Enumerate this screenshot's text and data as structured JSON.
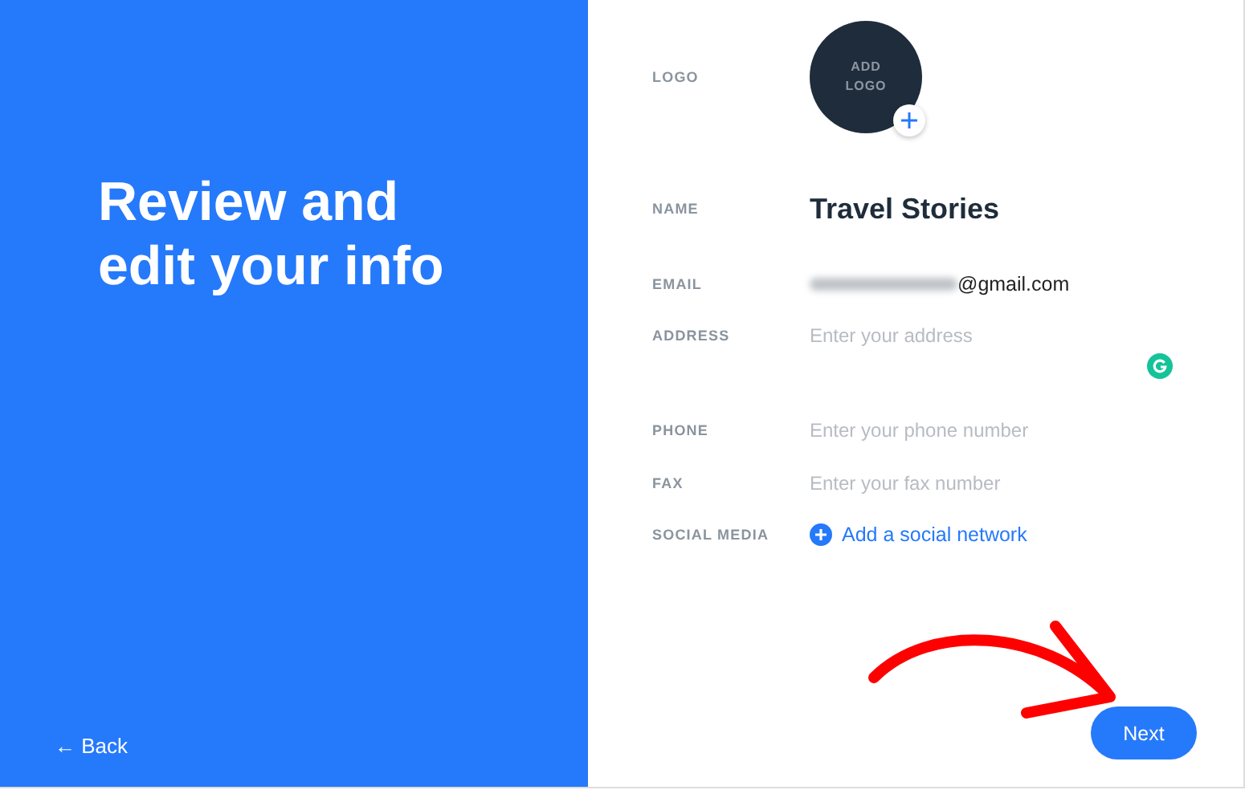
{
  "intro": {
    "title": "Review and edit your info",
    "back_link": "← Back"
  },
  "fields": [
    {
      "kind": "logo",
      "label": "LOGO",
      "value": "ADD LOGO"
    },
    {
      "kind": "name",
      "label": "NAME",
      "value": "Travel Stories"
    },
    {
      "kind": "email",
      "label": "EMAIL",
      "value": "@gmail.com"
    },
    {
      "kind": "textarea",
      "label": "ADDRESS",
      "placeholder": "Enter your address"
    },
    {
      "kind": "input",
      "label": "PHONE",
      "placeholder": "Enter your phone number"
    },
    {
      "kind": "input",
      "label": "FAX",
      "placeholder": "Enter your fax number"
    },
    {
      "kind": "link",
      "label": "SOCIAL MEDIA",
      "value": "Add a social network"
    }
  ],
  "next_button": "Next"
}
